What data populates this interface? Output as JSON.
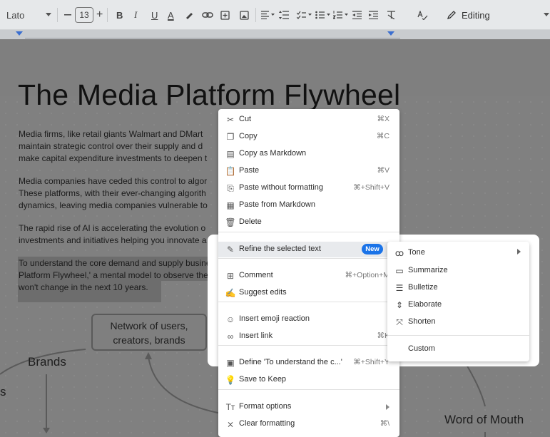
{
  "toolbar": {
    "font_name": "Lato",
    "font_size": "13",
    "mode_label": "Editing",
    "icons": [
      "dropdown-icon",
      "minus-icon",
      "plus-icon",
      "bold-icon",
      "italic-icon",
      "underline-icon",
      "text-color-icon",
      "highlight-icon",
      "link-icon",
      "comment-icon",
      "image-icon",
      "align-icon",
      "line-spacing-icon",
      "checklist-icon",
      "bullet-list-icon",
      "numbered-list-icon",
      "indent-decrease-icon",
      "indent-increase-icon",
      "clear-format-icon",
      "spellcheck-icon",
      "pencil-icon"
    ],
    "bold_glyph": "B",
    "italic_glyph": "I",
    "underline_glyph": "U",
    "text_color_glyph": "A"
  },
  "document": {
    "title": "The Media Platform Flywheel",
    "paragraphs": [
      [
        "Media firms, like retail giants Walmart and DMart",
        "maintain strategic control over their supply and d",
        "make capital expenditure investments to deepen t"
      ],
      [
        "Media companies have ceded this control to algor",
        "These platforms, with their ever-changing algorith",
        "dynamics, leaving media companies vulnerable to"
      ],
      [
        "The rapid rise of AI is accelerating the evolution o",
        "investments and initiatives helping you innovate a"
      ],
      [
        "To understand the core demand and supply busine",
        "Platform Flywheel,' a mental model to observe the",
        "won't change in the next 10 years."
      ]
    ]
  },
  "diagram": {
    "node_line1": "Network of users,",
    "node_line2": "creators, brands",
    "brands": "Brands",
    "left_edge_text": "s",
    "word_of_mouth": "Word of Mouth"
  },
  "context_menu": {
    "items": [
      {
        "icon": "scissors-icon",
        "glyph": "✂",
        "label": "Cut",
        "shortcut": "⌘X"
      },
      {
        "icon": "copy-icon",
        "glyph": "❐",
        "label": "Copy",
        "shortcut": "⌘C"
      },
      {
        "icon": "copy-markdown-icon",
        "glyph": "▤",
        "label": "Copy as Markdown",
        "shortcut": ""
      },
      {
        "icon": "paste-icon",
        "glyph": "📋",
        "label": "Paste",
        "shortcut": "⌘V"
      },
      {
        "icon": "paste-plain-icon",
        "glyph": "⎘",
        "label": "Paste without formatting",
        "shortcut": "⌘+Shift+V"
      },
      {
        "icon": "paste-markdown-icon",
        "glyph": "▦",
        "label": "Paste from Markdown",
        "shortcut": ""
      },
      {
        "icon": "trash-icon",
        "glyph": "🗑",
        "label": "Delete",
        "shortcut": ""
      },
      {
        "icon": "magic-wand-icon",
        "glyph": "✎",
        "label": "Refine the selected text",
        "shortcut": "",
        "badge": "New"
      },
      {
        "icon": "add-comment-icon",
        "glyph": "⊞",
        "label": "Comment",
        "shortcut": "⌘+Option+M"
      },
      {
        "icon": "suggest-edit-icon",
        "glyph": "✍",
        "label": "Suggest edits",
        "shortcut": ""
      },
      {
        "icon": "emoji-icon",
        "glyph": "☺",
        "label": "Insert emoji reaction",
        "shortcut": ""
      },
      {
        "icon": "link-icon",
        "glyph": "∞",
        "label": "Insert link",
        "shortcut": "⌘K"
      },
      {
        "icon": "define-icon",
        "glyph": "▣",
        "label": "Define 'To understand the c...'",
        "shortcut": "⌘+Shift+Y"
      },
      {
        "icon": "keep-icon",
        "glyph": "💡",
        "label": "Save to Keep",
        "shortcut": ""
      },
      {
        "icon": "format-options-icon",
        "glyph": "Tт",
        "label": "Format options",
        "shortcut": ""
      },
      {
        "icon": "clear-formatting-icon",
        "glyph": "⨯",
        "label": "Clear formatting",
        "shortcut": "⌘\\"
      }
    ]
  },
  "refine_submenu": {
    "items": [
      {
        "icon": "tone-icon",
        "glyph": "ꝏ",
        "label": "Tone",
        "has_arrow": true
      },
      {
        "icon": "summarize-icon",
        "glyph": "▭",
        "label": "Summarize"
      },
      {
        "icon": "bulletize-icon",
        "glyph": "☰",
        "label": "Bulletize"
      },
      {
        "icon": "elaborate-icon",
        "glyph": "⇕",
        "label": "Elaborate"
      },
      {
        "icon": "shorten-icon",
        "glyph": "⤧",
        "label": "Shorten"
      },
      {
        "icon": "",
        "glyph": "",
        "label": "Custom"
      }
    ]
  },
  "colors": {
    "accent": "#1a73e8",
    "dim_overlay": "#808080"
  }
}
